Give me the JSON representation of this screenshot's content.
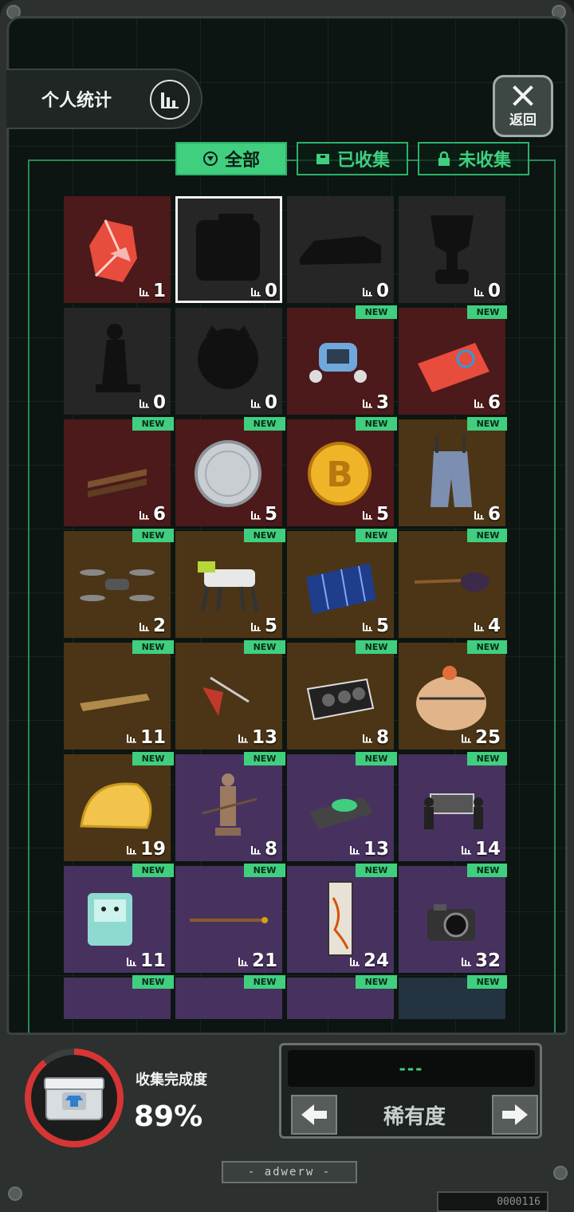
{
  "header": {
    "title": "个人统计",
    "back_label": "返回"
  },
  "tabs": [
    {
      "label": "全部",
      "active": true
    },
    {
      "label": "已收集",
      "active": false
    },
    {
      "label": "未收集",
      "active": false
    }
  ],
  "items": [
    {
      "count": "1",
      "rarity": "red",
      "new": false,
      "locked": false,
      "icon": "red-crystal-icon",
      "selected": false
    },
    {
      "count": "0",
      "rarity": "locked",
      "new": false,
      "locked": true,
      "icon": "locked-box-silhouette-icon",
      "selected": true
    },
    {
      "count": "0",
      "rarity": "locked",
      "new": false,
      "locked": true,
      "icon": "locked-car-silhouette-icon",
      "selected": false
    },
    {
      "count": "0",
      "rarity": "locked",
      "new": false,
      "locked": true,
      "icon": "locked-trophy-silhouette-icon",
      "selected": false
    },
    {
      "count": "0",
      "rarity": "locked",
      "new": false,
      "locked": true,
      "icon": "locked-statue-silhouette-icon",
      "selected": false
    },
    {
      "count": "0",
      "rarity": "locked",
      "new": false,
      "locked": true,
      "icon": "locked-creature-silhouette-icon",
      "selected": false
    },
    {
      "count": "3",
      "rarity": "red",
      "new": true,
      "locked": false,
      "icon": "robot-icon",
      "selected": false
    },
    {
      "count": "6",
      "rarity": "red",
      "new": true,
      "locked": false,
      "icon": "card-icon",
      "selected": false
    },
    {
      "count": "6",
      "rarity": "red",
      "new": true,
      "locked": false,
      "icon": "wooden-sticks-icon",
      "selected": false
    },
    {
      "count": "5",
      "rarity": "red",
      "new": true,
      "locked": false,
      "icon": "silver-coin-icon",
      "selected": false
    },
    {
      "count": "5",
      "rarity": "red",
      "new": true,
      "locked": false,
      "icon": "bitcoin-icon",
      "selected": false
    },
    {
      "count": "6",
      "rarity": "gold",
      "new": true,
      "locked": false,
      "icon": "overalls-icon",
      "selected": false
    },
    {
      "count": "2",
      "rarity": "gold",
      "new": true,
      "locked": false,
      "icon": "drone-icon",
      "selected": false
    },
    {
      "count": "5",
      "rarity": "gold",
      "new": true,
      "locked": false,
      "icon": "robot-dog-icon",
      "selected": false
    },
    {
      "count": "5",
      "rarity": "gold",
      "new": true,
      "locked": false,
      "icon": "solar-panel-icon",
      "selected": false
    },
    {
      "count": "4",
      "rarity": "gold",
      "new": true,
      "locked": false,
      "icon": "guitar-icon",
      "selected": false
    },
    {
      "count": "11",
      "rarity": "gold",
      "new": true,
      "locked": false,
      "icon": "phone-icon",
      "selected": false
    },
    {
      "count": "13",
      "rarity": "gold",
      "new": true,
      "locked": false,
      "icon": "plumb-bob-icon",
      "selected": false
    },
    {
      "count": "8",
      "rarity": "gold",
      "new": true,
      "locked": false,
      "icon": "graphics-card-icon",
      "selected": false
    },
    {
      "count": "25",
      "rarity": "gold",
      "new": true,
      "locked": false,
      "icon": "helmet-icon",
      "selected": false
    },
    {
      "count": "19",
      "rarity": "gold",
      "new": true,
      "locked": false,
      "icon": "bread-icon",
      "selected": false
    },
    {
      "count": "8",
      "rarity": "purple",
      "new": true,
      "locked": false,
      "icon": "terracotta-warrior-icon",
      "selected": false
    },
    {
      "count": "13",
      "rarity": "purple",
      "new": true,
      "locked": false,
      "icon": "turntable-icon",
      "selected": false
    },
    {
      "count": "14",
      "rarity": "purple",
      "new": true,
      "locked": false,
      "icon": "coffin-dance-icon",
      "selected": false
    },
    {
      "count": "11",
      "rarity": "purple",
      "new": true,
      "locked": false,
      "icon": "bmo-robot-icon",
      "selected": false
    },
    {
      "count": "21",
      "rarity": "purple",
      "new": true,
      "locked": false,
      "icon": "staff-icon",
      "selected": false
    },
    {
      "count": "24",
      "rarity": "purple",
      "new": true,
      "locked": false,
      "icon": "scroll-painting-icon",
      "selected": false
    },
    {
      "count": "32",
      "rarity": "purple",
      "new": true,
      "locked": false,
      "icon": "camera-icon",
      "selected": false
    },
    {
      "count": "",
      "rarity": "purple",
      "new": true,
      "locked": false,
      "icon": "gear-item-icon",
      "selected": false
    },
    {
      "count": "",
      "rarity": "purple",
      "new": true,
      "locked": false,
      "icon": "machine-item-icon",
      "selected": false
    },
    {
      "count": "",
      "rarity": "purple",
      "new": true,
      "locked": false,
      "icon": "figure-item-icon",
      "selected": false
    },
    {
      "count": "",
      "rarity": "blue",
      "new": true,
      "locked": false,
      "icon": "basketball-icon",
      "selected": false
    }
  ],
  "new_badge_label": "NEW",
  "progress": {
    "label": "收集完成度",
    "value": "89%",
    "fraction": 0.89
  },
  "sort": {
    "display": "---",
    "label": "稀有度"
  },
  "footer": {
    "brand": "- adwerw -",
    "serial": "0000116"
  },
  "colors": {
    "accent": "#3fcf7f",
    "red": "#4c1a1a",
    "gold": "#4b3516",
    "purple": "#47325f",
    "blue": "#243340",
    "locked": "#262626"
  }
}
